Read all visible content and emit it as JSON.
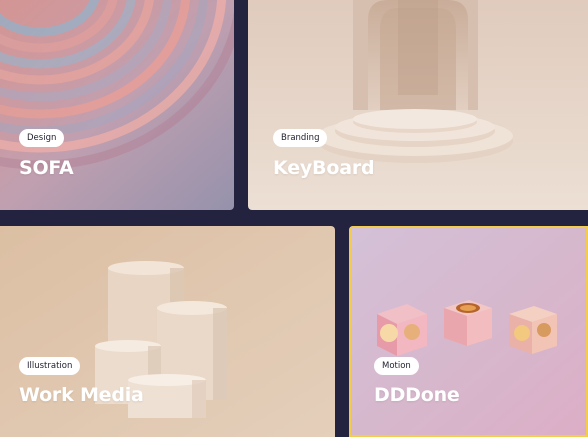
{
  "cards": [
    {
      "tag": "Design",
      "title": "SOFA"
    },
    {
      "tag": "Branding",
      "title": "KeyBoard"
    },
    {
      "tag": "Illustration",
      "title": "Work Media"
    },
    {
      "tag": "Motion",
      "title": "DDDone"
    }
  ],
  "colors": {
    "background": "#24233f",
    "selected_outline": "#f3cc4f",
    "tag_background": "#ffffff"
  },
  "selected_card": "DDDone"
}
